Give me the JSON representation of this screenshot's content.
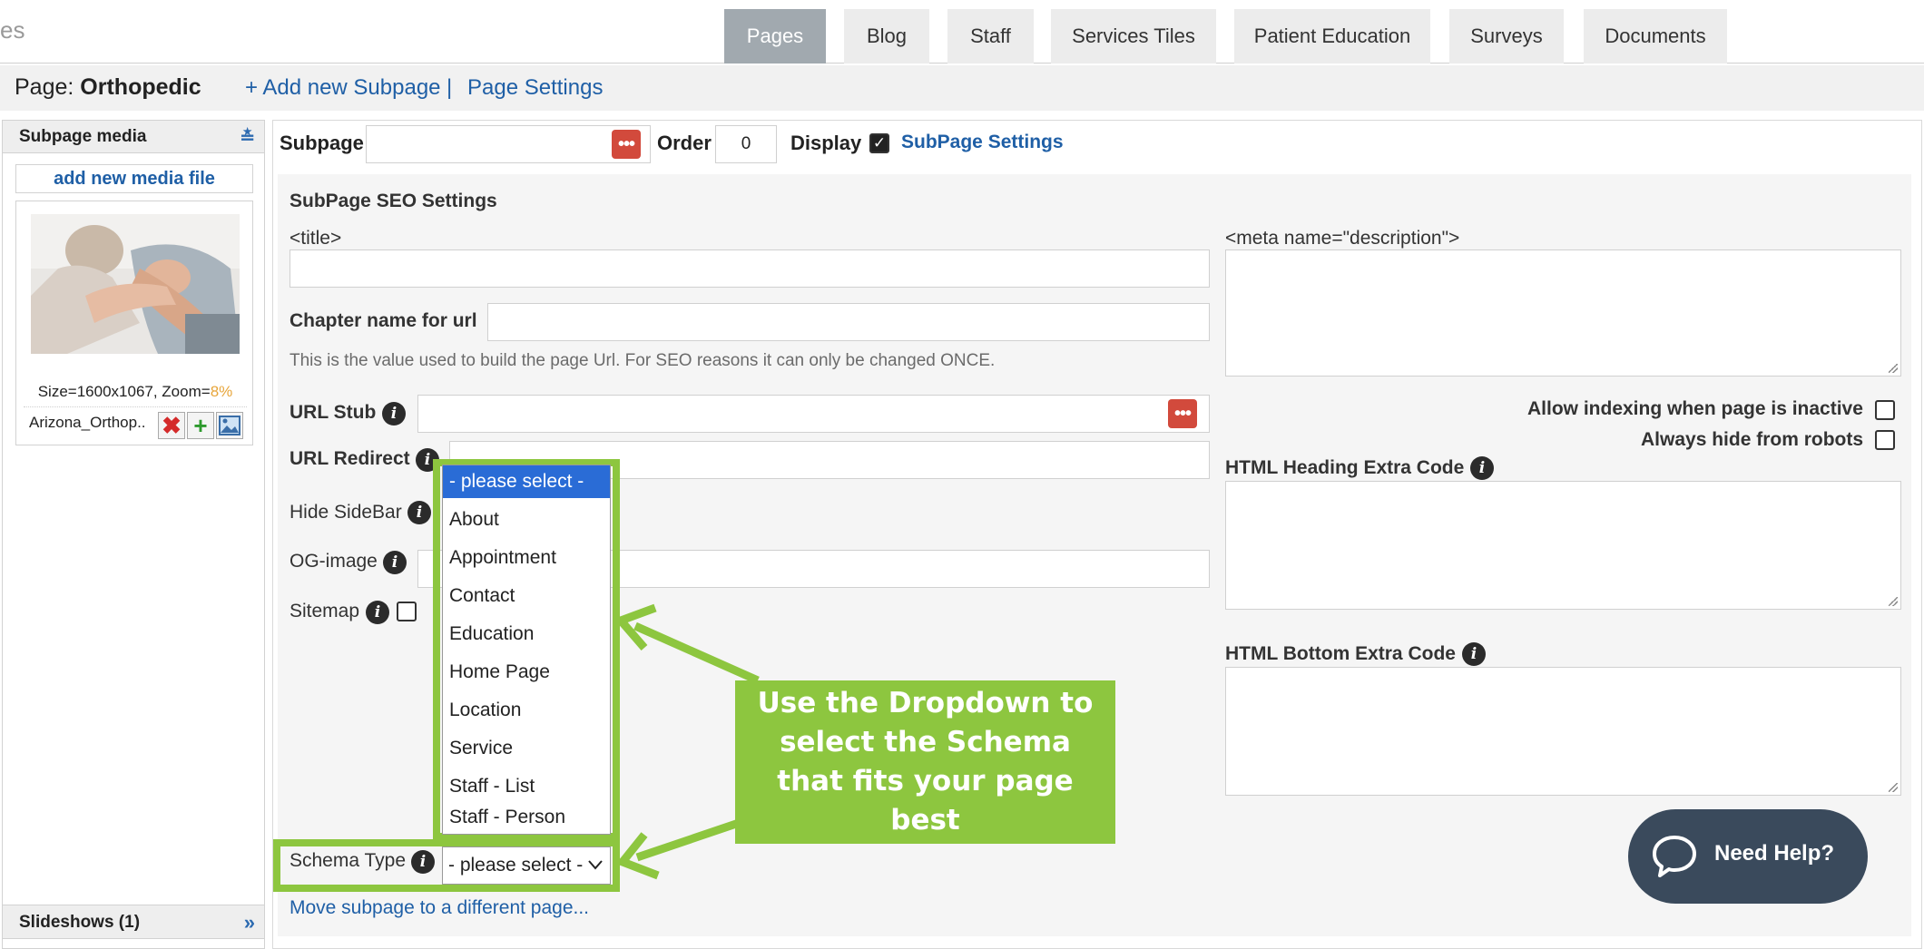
{
  "top": {
    "fragment": "es",
    "tabs": [
      {
        "label": "Pages",
        "active": true
      },
      {
        "label": "Blog"
      },
      {
        "label": "Staff"
      },
      {
        "label": "Services Tiles"
      },
      {
        "label": "Patient Education"
      },
      {
        "label": "Surveys"
      },
      {
        "label": "Documents"
      }
    ]
  },
  "header": {
    "page_label": "Page:",
    "page_name": "Orthopedic",
    "add_subpage": "+ Add new Subpage",
    "separator": "|",
    "page_settings": "Page Settings"
  },
  "sidebar": {
    "title": "Subpage media",
    "add_media": "add new media file",
    "size_text": "Size=1600x1067, Zoom=",
    "zoom": "8%",
    "file_name": "Arizona_Orthop..",
    "slideshows": "Slideshows (1)"
  },
  "toprow": {
    "subpage_label": "Subpage",
    "subpage_value": "",
    "order_label": "Order",
    "order_value": "0",
    "display_label": "Display",
    "display_checked": true,
    "subpage_settings": "SubPage Settings"
  },
  "seo": {
    "section_title": "SubPage SEO Settings",
    "title_label": "<title>",
    "meta_desc_label": "<meta name=\"description\">",
    "chapter_label": "Chapter name for url",
    "chapter_hint": "This is the value used to build the page Url. For SEO reasons it can only be changed ONCE.",
    "url_stub_label": "URL Stub",
    "url_redirect_label": "URL Redirect",
    "hide_sidebar_label": "Hide SideBar",
    "og_image_label": "OG-image",
    "sitemap_label": "Sitemap",
    "allow_indexing_label": "Allow indexing when page is inactive",
    "hide_robots_label": "Always hide from robots",
    "heading_code_label": "HTML Heading Extra Code",
    "bottom_code_label": "HTML Bottom Extra Code",
    "schema_label": "Schema Type",
    "schema_value": "- please select -",
    "move_link": "Move subpage to a different page..."
  },
  "schema_options": [
    "- please select -",
    "About",
    "Appointment",
    "Contact",
    "Education",
    "Home Page",
    "Location",
    "Service",
    "Staff - List",
    "Staff - Person"
  ],
  "callout": "Use the Dropdown to select the Schema that fits your page best",
  "help": "Need Help?",
  "colors": {
    "accent_green": "#8dc63f",
    "link_blue": "#1f5fa6",
    "dropdown_selected": "#2a6cd6",
    "help_bg": "#3a4a5c",
    "red_button": "#d24a3c"
  }
}
